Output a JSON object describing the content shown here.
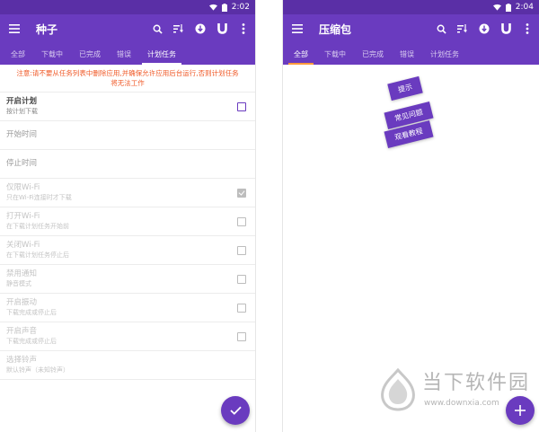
{
  "left": {
    "status_time": "2:02",
    "title": "种子",
    "tabs": [
      {
        "label": "全部"
      },
      {
        "label": "下载中"
      },
      {
        "label": "已完成"
      },
      {
        "label": "错误"
      },
      {
        "label": "计划任务"
      }
    ],
    "active_tab": "计划任务",
    "notice_line1": "注意:请不要从任务列表中删除应用,并确保允许应用后台运行,否则计划任务",
    "notice_line2": "将无法工作",
    "settings": [
      {
        "title": "开启计划",
        "subtitle": "按计划下载",
        "checkbox": "unchecked",
        "enabled": true
      },
      {
        "title": "开始时间",
        "subtitle": "",
        "enabled": true
      },
      {
        "title": "停止时间",
        "subtitle": "",
        "enabled": true
      },
      {
        "title": "仅限Wi-Fi",
        "subtitle": "只在Wi-Fi连接时才下载",
        "checkbox": "checked",
        "enabled": false
      },
      {
        "title": "打开Wi-Fi",
        "subtitle": "在下载计划任务开始前",
        "checkbox": "unchecked",
        "enabled": false
      },
      {
        "title": "关闭Wi-Fi",
        "subtitle": "在下载计划任务停止后",
        "checkbox": "unchecked",
        "enabled": false
      },
      {
        "title": "禁用通知",
        "subtitle": "静音模式",
        "checkbox": "unchecked",
        "enabled": false
      },
      {
        "title": "开启振动",
        "subtitle": "下载完成或停止后",
        "checkbox": "unchecked",
        "enabled": false
      },
      {
        "title": "开启声音",
        "subtitle": "下载完成或停止后",
        "checkbox": "unchecked",
        "enabled": false
      },
      {
        "title": "选择铃声",
        "subtitle": "默认铃声（未知铃声）",
        "enabled": false
      }
    ],
    "fab_icon": "check-icon"
  },
  "right": {
    "status_time": "2:04",
    "title": "压缩包",
    "tabs": [
      {
        "label": "全部"
      },
      {
        "label": "下载中"
      },
      {
        "label": "已完成"
      },
      {
        "label": "错误"
      },
      {
        "label": "计划任务"
      }
    ],
    "active_tab": "全部",
    "tips": [
      {
        "label": "提示"
      },
      {
        "label": "常见问题"
      },
      {
        "label": "观看教程"
      }
    ],
    "fab_icon": "plus-icon"
  },
  "toolbar_icons": [
    "search-icon",
    "sort-icon",
    "torrent-icon",
    "magnet-icon",
    "more-icon"
  ],
  "watermark": {
    "name": "当下软件园",
    "url": "www.downxia.com"
  },
  "colors": {
    "primary": "#6a3bbf",
    "status_bar": "#5a2fa6",
    "notice": "#f05a28",
    "tab_indicator_right": "#ff9a3c"
  }
}
